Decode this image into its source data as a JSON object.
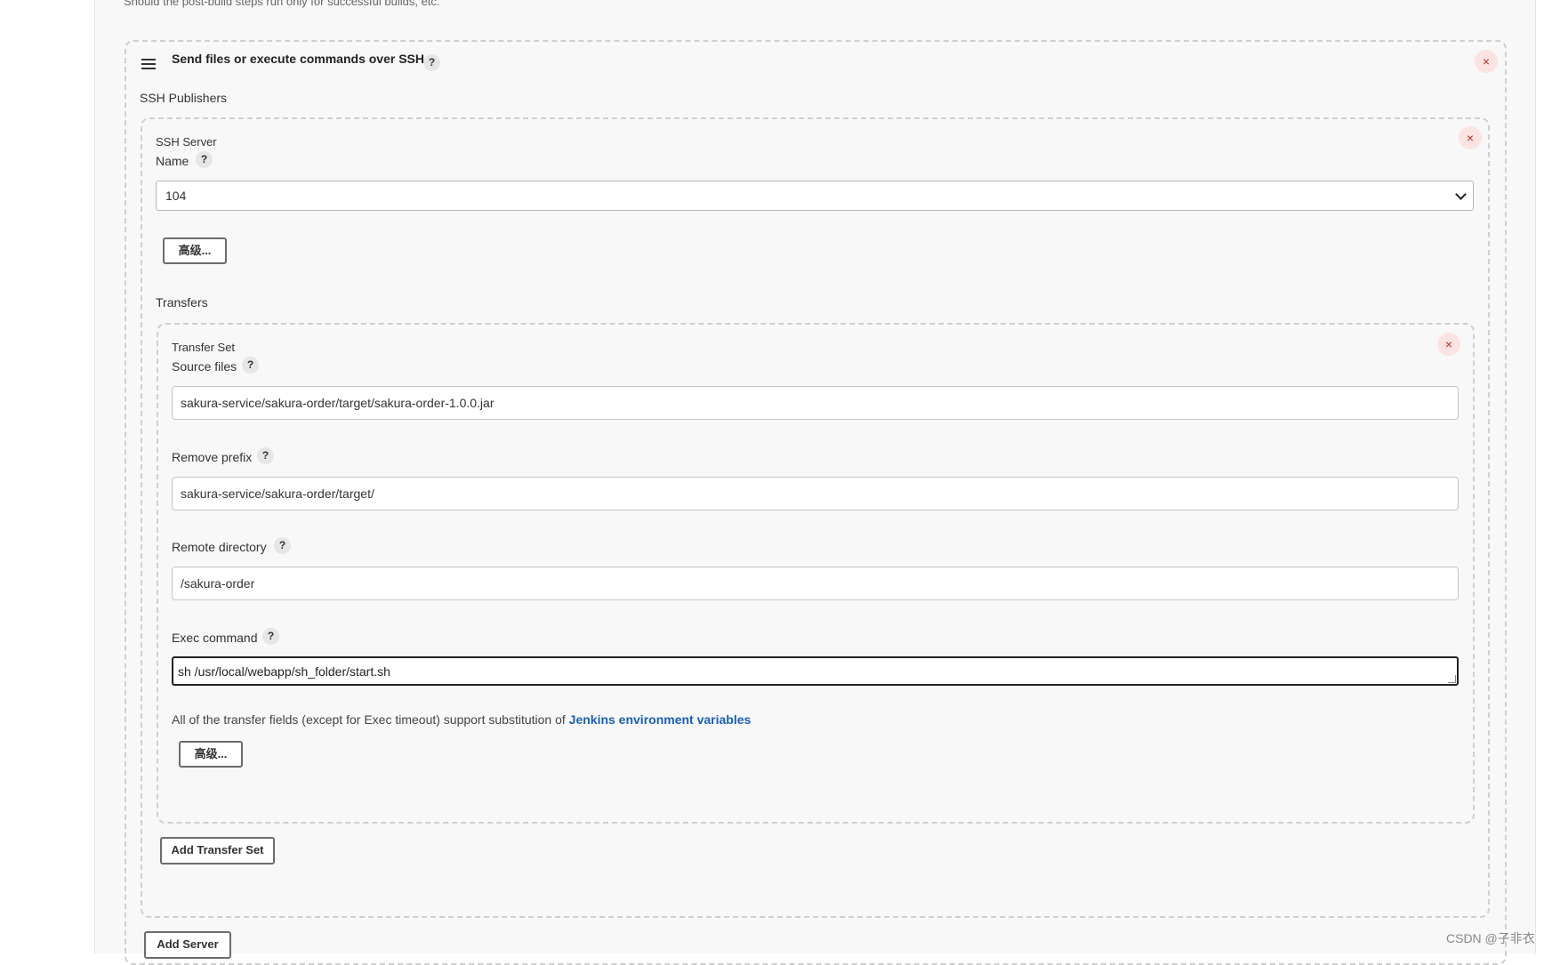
{
  "hint_text": "Should the post-build steps run only for successful builds, etc.",
  "step": {
    "title": "Send files or execute commands over SSH",
    "help": "?",
    "close": "×",
    "publishers_label": "SSH Publishers"
  },
  "server": {
    "heading": "SSH Server",
    "name_label": "Name",
    "help": "?",
    "close": "×",
    "name_value": "104",
    "advanced_button": "高级...",
    "transfers_label": "Transfers",
    "add_transfer_button": "Add Transfer Set",
    "add_server_button": "Add Server"
  },
  "transfer": {
    "heading": "Transfer Set",
    "close": "×",
    "source_label": "Source files",
    "source_value": "sakura-service/sakura-order/target/sakura-order-1.0.0.jar",
    "remove_prefix_label": "Remove prefix",
    "remove_prefix_value": "sakura-service/sakura-order/target/",
    "remote_dir_label": "Remote directory",
    "remote_dir_value": "/sakura-order",
    "exec_label": "Exec command",
    "exec_value": "sh /usr/local/webapp/sh_folder/start.sh",
    "note_text": "All of the transfer fields (except for Exec timeout) support substitution of ",
    "note_link": "Jenkins environment variables",
    "advanced_button": "高级...",
    "help": "?"
  },
  "watermark": "CSDN @子非衣"
}
